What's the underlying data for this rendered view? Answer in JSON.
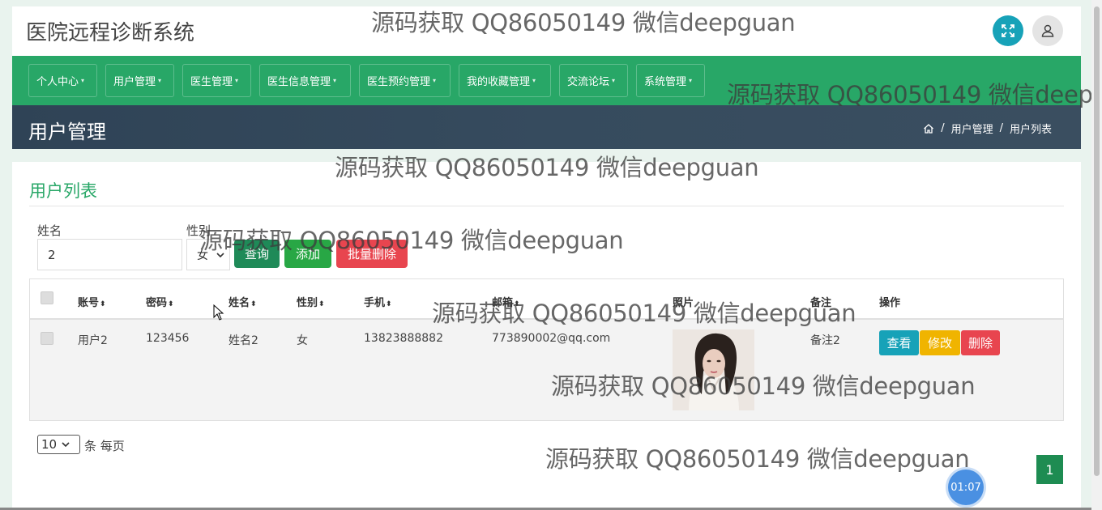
{
  "header": {
    "app_title": "医院远程诊断系统"
  },
  "nav": {
    "items": [
      {
        "label": "个人中心"
      },
      {
        "label": "用户管理"
      },
      {
        "label": "医生管理"
      },
      {
        "label": "医生信息管理"
      },
      {
        "label": "医生预约管理"
      },
      {
        "label": "我的收藏管理"
      },
      {
        "label": "交流论坛"
      },
      {
        "label": "系统管理"
      }
    ],
    "caret": "▾"
  },
  "page_header": {
    "title": "用户管理",
    "breadcrumb": [
      "用户管理",
      "用户列表"
    ],
    "separator": "/"
  },
  "card": {
    "title": "用户列表"
  },
  "search": {
    "name_label": "姓名",
    "name_value": "2",
    "sex_label": "性别",
    "sex_value": "女",
    "query_label": "查询",
    "add_label": "添加",
    "batch_delete_label": "批量删除"
  },
  "table": {
    "sort_icon": "⬍",
    "columns": [
      "账号",
      "密码",
      "姓名",
      "性别",
      "手机",
      "邮箱",
      "照片",
      "备注",
      "操作"
    ],
    "rows": [
      {
        "account": "用户2",
        "password": "123456",
        "name": "姓名2",
        "sex": "女",
        "phone": "13823888882",
        "email": "773890002@qq.com",
        "note": "备注2",
        "view_label": "查看",
        "edit_label": "修改",
        "delete_label": "删除"
      }
    ]
  },
  "pagination": {
    "page_size": "10",
    "per_page_label": "条 每页",
    "current_page": "1"
  },
  "timer": "01:07",
  "watermark": "源码获取 QQ86050149 微信deepguan",
  "colors": {
    "primary_green": "#28a767",
    "info": "#17a2b8",
    "warning": "#f0b400",
    "danger": "#e8454f",
    "header_dark": "#2f4356"
  }
}
